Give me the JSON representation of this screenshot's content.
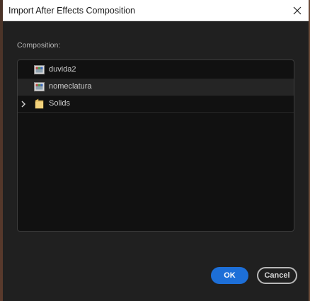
{
  "window": {
    "title": "Import After Effects Composition"
  },
  "composition_label": "Composition:",
  "tree": {
    "items": [
      {
        "label": "duvida2",
        "icon": "composition-icon",
        "selected": false
      },
      {
        "label": "nomeclatura",
        "icon": "composition-icon",
        "selected": true
      },
      {
        "label": "Solids",
        "icon": "folder-icon",
        "expandable": true,
        "expanded": false
      }
    ]
  },
  "buttons": {
    "ok_label": "OK",
    "cancel_label": "Cancel"
  },
  "colors": {
    "accent": "#1d6fd8",
    "dialog_bg": "#202020",
    "list_bg": "#111111",
    "selected_row": "#252525"
  }
}
